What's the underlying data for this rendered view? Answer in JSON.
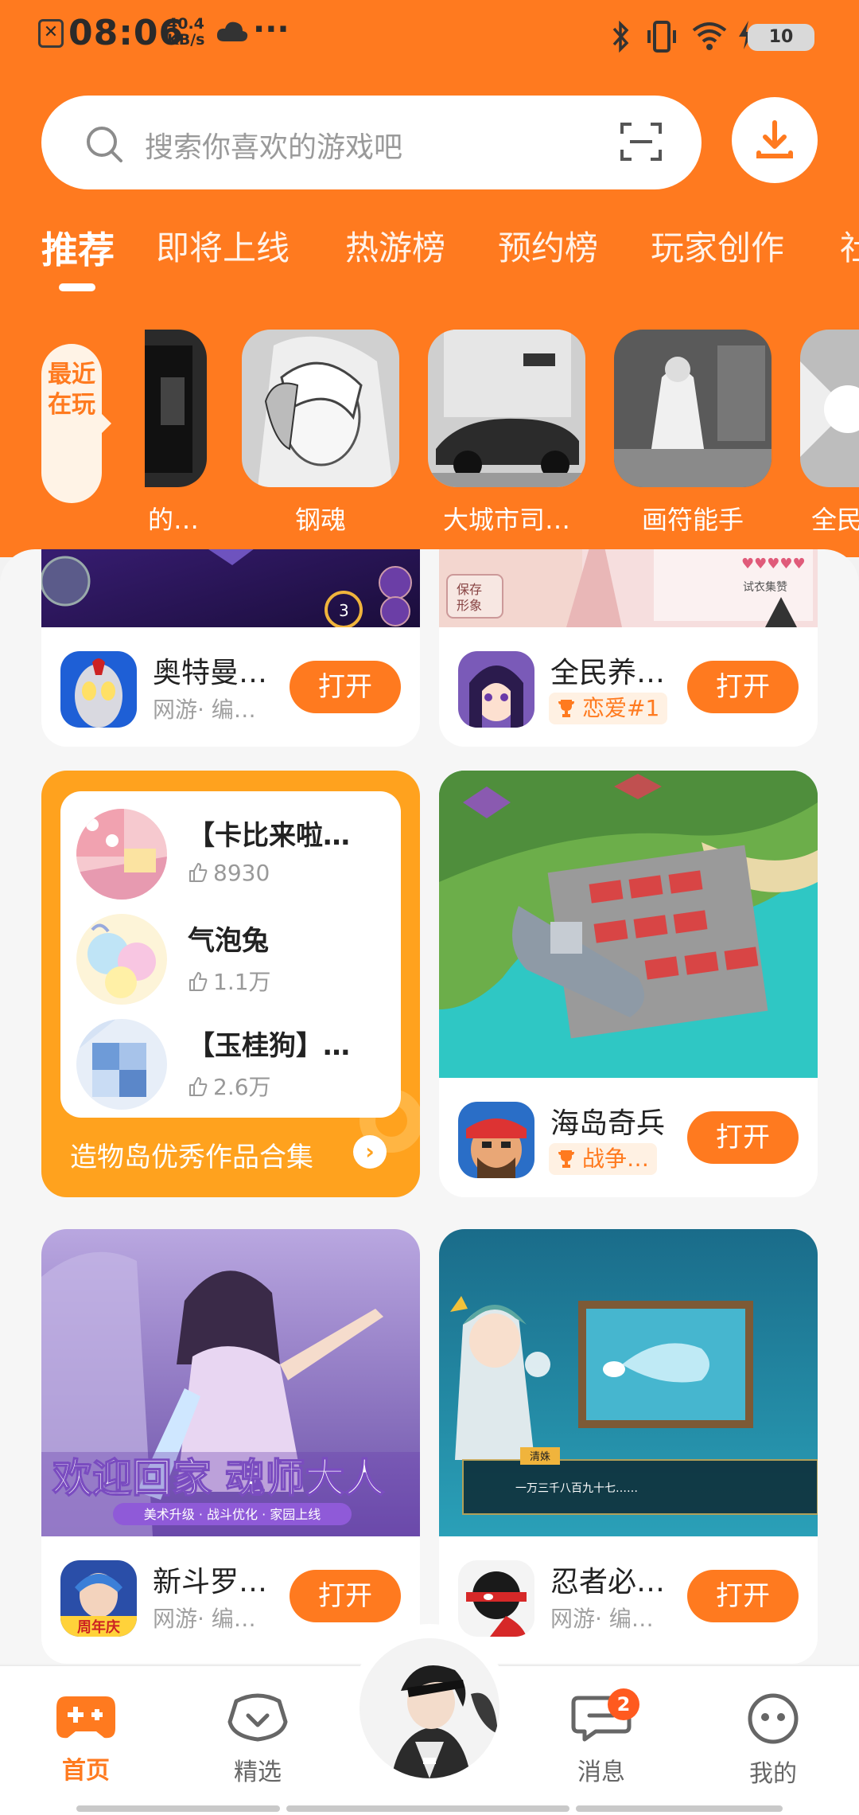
{
  "statusbar": {
    "time": "08:06",
    "speed_value": "40.4",
    "speed_unit": "KB/s",
    "battery": "10"
  },
  "search": {
    "placeholder": "搜索你喜欢的游戏吧"
  },
  "tabs": [
    {
      "label": "推荐",
      "active": true
    },
    {
      "label": "即将上线"
    },
    {
      "label": "热游榜"
    },
    {
      "label": "预约榜"
    },
    {
      "label": "玩家创作"
    },
    {
      "label": "社"
    }
  ],
  "recent": {
    "label": "最近在玩",
    "games": [
      {
        "name": "的…"
      },
      {
        "name": "钢魂"
      },
      {
        "name": "大城市司…"
      },
      {
        "name": "画符能手"
      },
      {
        "name": "全民"
      }
    ]
  },
  "feed": {
    "cards": [
      {
        "name": "奥特曼…",
        "subtitle": "网游· 编…",
        "button": "打开"
      },
      {
        "name": "全民养…",
        "tag": "恋爱#1",
        "button": "打开"
      },
      {
        "name": "海岛奇兵",
        "tag": "战争…",
        "button": "打开"
      },
      {
        "name": "新斗罗…",
        "subtitle": "网游· 编…",
        "button": "打开",
        "banner_title": "欢迎回家 魂师大人",
        "banner_sub": "美术升级 · 战斗优化 · 家园上线",
        "icon_text": "周年庆"
      },
      {
        "name": "忍者必…",
        "subtitle": "网游· 编…",
        "button": "打开",
        "scene_caption": "清姝",
        "scene_text": "一万三千八百九十七……"
      }
    ],
    "collection": {
      "items": [
        {
          "title": "【卡比来啦…",
          "likes": "8930"
        },
        {
          "title": "气泡兔",
          "likes": "1.1万"
        },
        {
          "title": "【玉桂狗】…",
          "likes": "2.6万"
        }
      ],
      "footer": "造物岛优秀作品合集",
      "arrow": "›"
    }
  },
  "bottom_nav": [
    {
      "label": "首页",
      "active": true
    },
    {
      "label": "精选"
    },
    {
      "label": "消息",
      "badge": "2"
    },
    {
      "label": "我的"
    }
  ],
  "colors": {
    "brand": "#ff7a1f",
    "collection_bg": "#ffa21e",
    "background": "#f6f6f6"
  }
}
